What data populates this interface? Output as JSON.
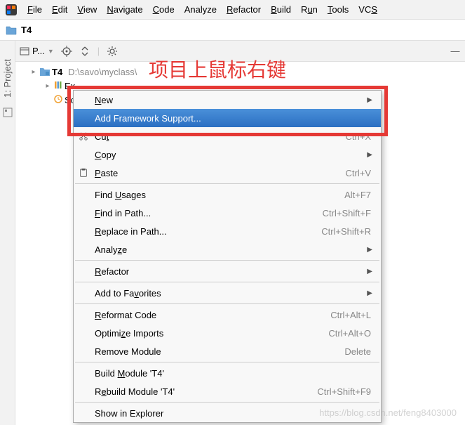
{
  "menubar": {
    "items": [
      {
        "label": "File",
        "u": "F"
      },
      {
        "label": "Edit",
        "u": "E"
      },
      {
        "label": "View",
        "u": "V"
      },
      {
        "label": "Navigate",
        "u": "N"
      },
      {
        "label": "Code",
        "u": "C"
      },
      {
        "label": "Analyze",
        "u": null
      },
      {
        "label": "Refactor",
        "u": "R"
      },
      {
        "label": "Build",
        "u": "B"
      },
      {
        "label": "Run",
        "u": "u"
      },
      {
        "label": "Tools",
        "u": "T"
      },
      {
        "label": "VCS",
        "u": "S"
      }
    ]
  },
  "path": {
    "project": "T4"
  },
  "panel": {
    "title": "P...",
    "rail_label": "1: Project"
  },
  "tree": {
    "root": {
      "name": "T4",
      "path": "D:\\savo\\myclass\\"
    },
    "children": [
      {
        "name": "Ex"
      },
      {
        "name": "Sc"
      }
    ]
  },
  "context_menu": {
    "items": [
      {
        "label": "New",
        "submenu": true
      },
      {
        "label": "Add Framework Support...",
        "selected": true
      },
      {
        "label": "Cut",
        "shortcut": "Ctrl+X",
        "icon": "cut"
      },
      {
        "label": "Copy",
        "submenu": true
      },
      {
        "label": "Paste",
        "shortcut": "Ctrl+V",
        "icon": "paste"
      },
      {
        "sep": true
      },
      {
        "label": "Find Usages",
        "shortcut": "Alt+F7"
      },
      {
        "label": "Find in Path...",
        "shortcut": "Ctrl+Shift+F"
      },
      {
        "label": "Replace in Path...",
        "shortcut": "Ctrl+Shift+R"
      },
      {
        "label": "Analyze",
        "submenu": true
      },
      {
        "sep": true
      },
      {
        "label": "Refactor",
        "submenu": true
      },
      {
        "sep": true
      },
      {
        "label": "Add to Favorites",
        "submenu": true
      },
      {
        "sep": true
      },
      {
        "label": "Reformat Code",
        "shortcut": "Ctrl+Alt+L"
      },
      {
        "label": "Optimize Imports",
        "shortcut": "Ctrl+Alt+O"
      },
      {
        "label": "Remove Module",
        "shortcut": "Delete"
      },
      {
        "sep": true
      },
      {
        "label": "Build Module 'T4'"
      },
      {
        "label": "Rebuild Module 'T4'",
        "shortcut": "Ctrl+Shift+F9"
      },
      {
        "sep": true
      },
      {
        "label": "Show in Explorer"
      }
    ],
    "u_map": {
      "New": "N",
      "Cut": "t",
      "Copy": "C",
      "Paste": "P",
      "Find Usages": "U",
      "Find in Path...": "F",
      "Replace in Path...": "R",
      "Analyze": "z",
      "Refactor": "R",
      "Add to Favorites": "v",
      "Reformat Code": "R",
      "Optimize Imports": "z",
      "Build Module 'T4'": "M",
      "Rebuild Module 'T4'": "e"
    }
  },
  "annotation": "项目上鼠标右键",
  "watermark": "https://blog.csdn.net/feng8403000"
}
